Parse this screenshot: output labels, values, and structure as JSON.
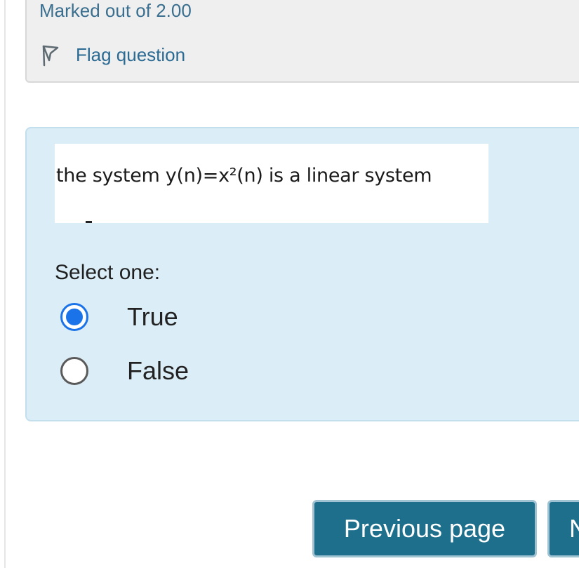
{
  "info": {
    "marked_out": "Marked out of 2.00",
    "flag_label": "Flag question",
    "flag_icon": "flag-icon"
  },
  "question": {
    "text": "the system y(n)=x²(n) is  a linear system",
    "prompt": "Select one:",
    "options": [
      {
        "label": "True",
        "selected": true
      },
      {
        "label": "False",
        "selected": false
      }
    ]
  },
  "navigation": {
    "previous_label": "Previous page",
    "next_label_partial": "N"
  },
  "colors": {
    "accent": "#1a73e8",
    "button_bg": "#1e6f8c",
    "link": "#2a6a93",
    "question_bg": "#dbedf6",
    "info_bg": "#efefef"
  }
}
